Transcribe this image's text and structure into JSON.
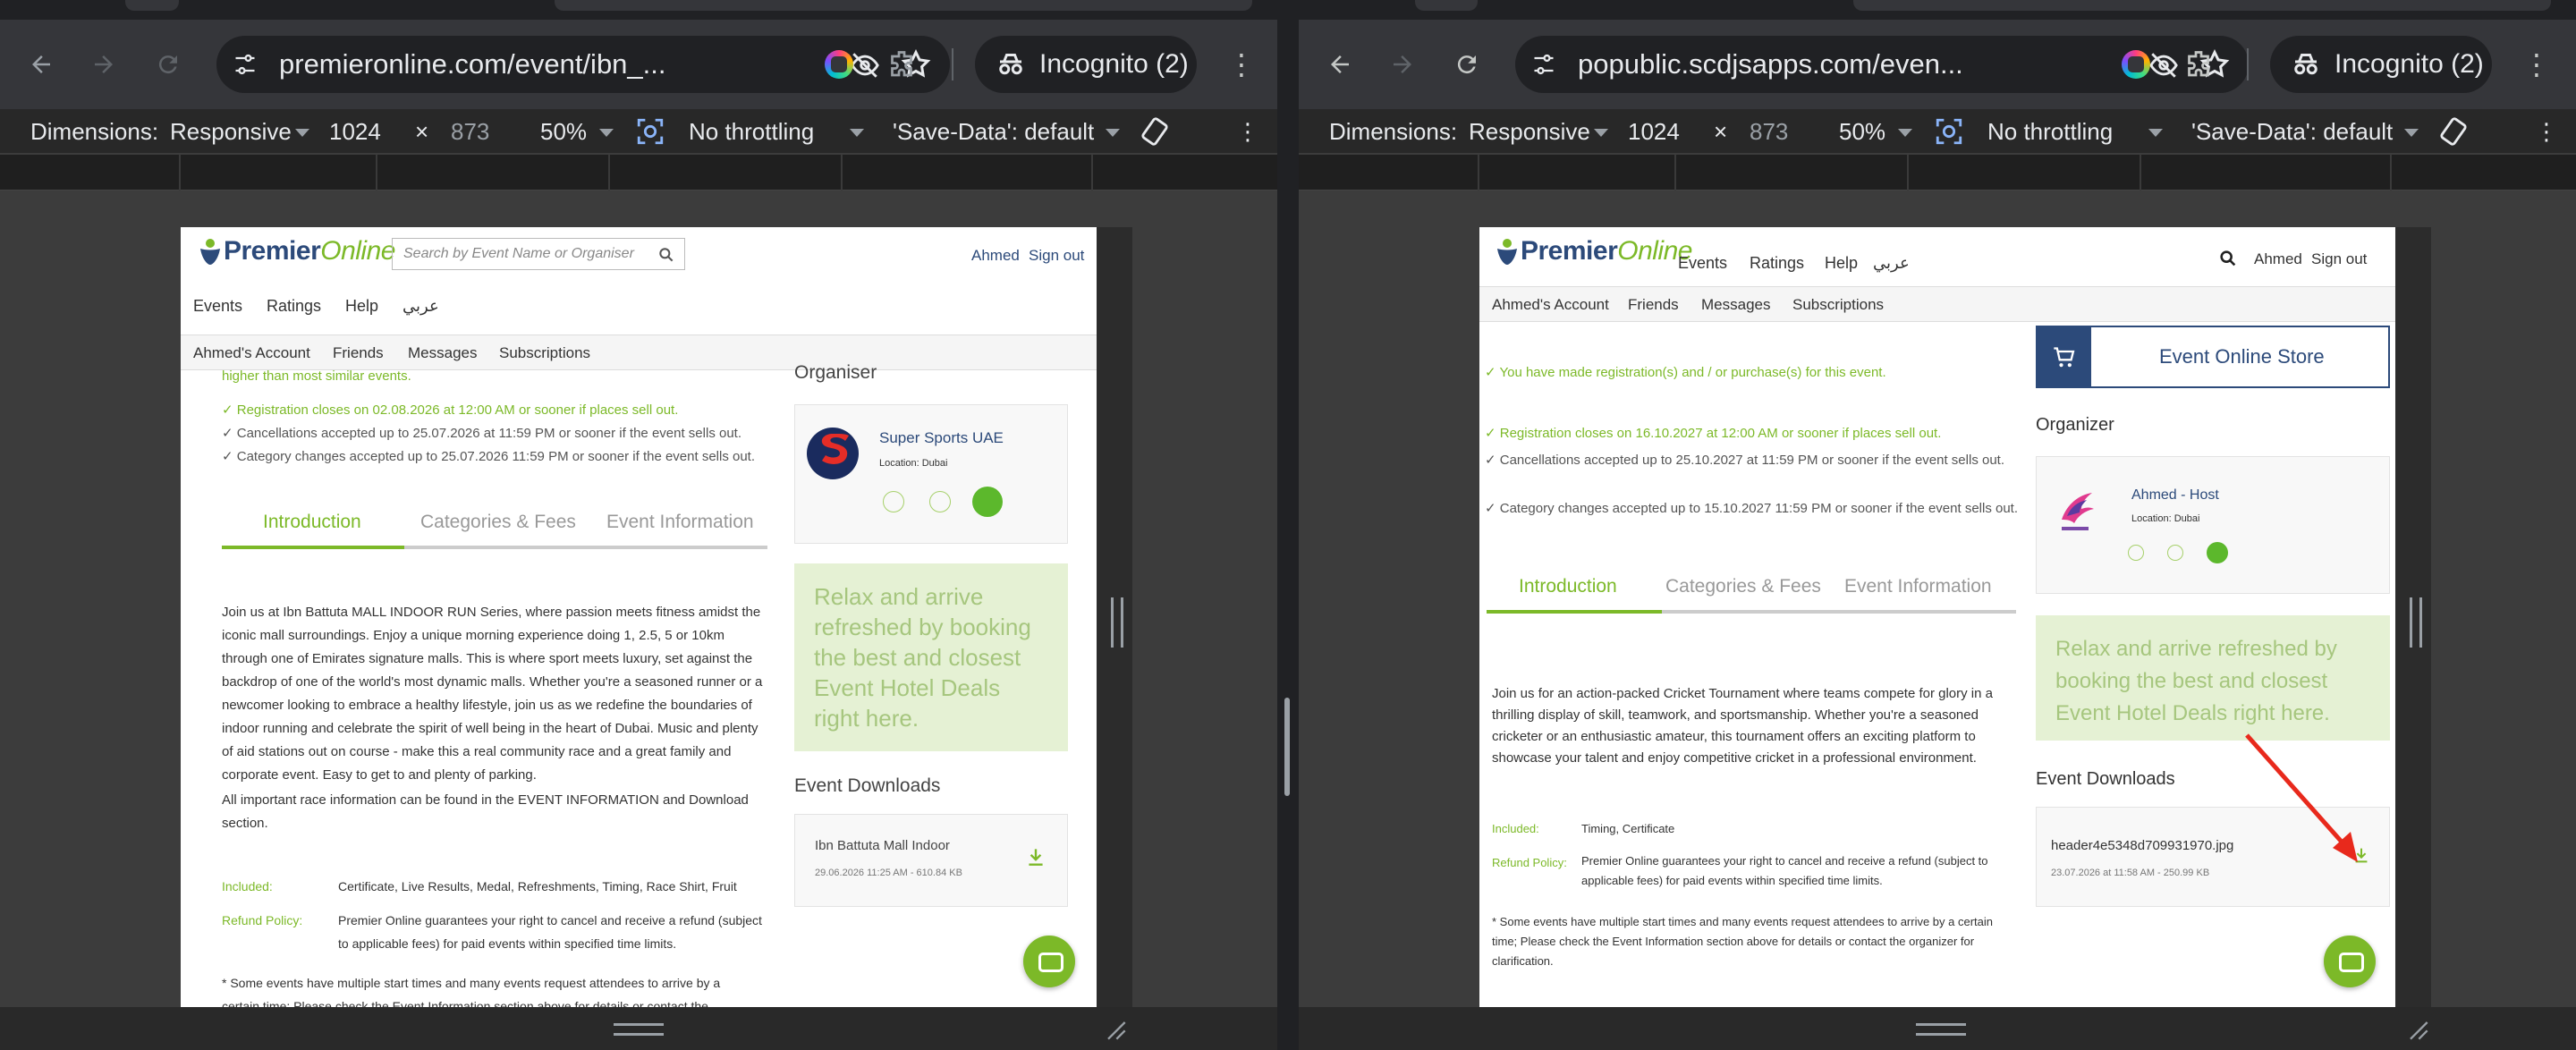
{
  "browser": {
    "incognito_label": "Incognito (2)"
  },
  "devtools": {
    "dimensions_label": "Dimensions:",
    "device": "Responsive",
    "width": "1024",
    "times": "×",
    "height": "873",
    "zoom": "50%",
    "throttling": "No throttling",
    "save_data": "'Save-Data': default"
  },
  "left": {
    "url": "premieronline.com/event/ibn_...",
    "site": {
      "logo_p": "Premier",
      "logo_o": "Online",
      "search_placeholder": "Search by Event Name or Organiser",
      "user": "Ahmed",
      "signout": "Sign out",
      "nav": [
        "Events",
        "Ratings",
        "Help",
        "عربي"
      ],
      "subnav": [
        "Ahmed's Account",
        "Friends",
        "Messages",
        "Subscriptions"
      ]
    },
    "cut_text": "higher than most similar events.",
    "reg_lines": [
      "Registration closes on 02.08.2026 at 12:00 AM or sooner if places sell out.",
      "Cancellations accepted up to 25.07.2026 at 11:59 PM or sooner if the event sells out.",
      "Category changes accepted up to 25.07.2026 11:59 PM or sooner if the event sells out."
    ],
    "tabs": [
      "Introduction",
      "Categories & Fees",
      "Event Information"
    ],
    "intro": "Join us at Ibn Battuta MALL INDOOR RUN Series, where passion meets fitness amidst the iconic mall surroundings. Enjoy a unique morning experience doing 1, 2.5, 5 or 10km through one of Emirates signature malls. This is where sport meets luxury, set against the backdrop of one of the world's most dynamic malls. Whether you're a seasoned runner or a newcomer looking to embrace a healthy lifestyle, join us as we redefine the boundaries of indoor running and celebrate the spirit of well being in the heart of Dubai.  Music and plenty of aid stations out on course - make this a real community race and a great family and corporate event. Easy to get to and plenty of parking.",
    "intro2": "All important race information can be found in the EVENT INFORMATION and Download section.",
    "included_label": "Included:",
    "included": "Certificate, Live Results, Medal, Refreshments, Timing, Race Shirt, Fruit",
    "refund_label": "Refund Policy:",
    "refund": "Premier Online guarantees your right to cancel and receive a refund (subject to applicable fees) for paid events within specified time limits.",
    "footnote": "* Some events have multiple start times and many events request attendees to arrive by a certain time; Please check the Event Information section above for details or contact the organiser for",
    "organiser_heading": "Organiser",
    "organiser_name": "Super Sports UAE",
    "organiser_location": "Location: Dubai",
    "hotel": "Relax and arrive refreshed by booking the best and closest Event Hotel Deals right here.",
    "downloads_heading": "Event Downloads",
    "download_name": "Ibn Battuta Mall Indoor",
    "download_meta": "29.06.2026 11:25 AM - 610.84 KB"
  },
  "right": {
    "url": "popublic.scdjsapps.com/even...",
    "site": {
      "logo_p": "Premier",
      "logo_o": "Online",
      "nav": [
        "Events",
        "Ratings",
        "Help",
        "عربي"
      ],
      "user": "Ahmed",
      "signout": "Sign out",
      "subnav": [
        "Ahmed's Account",
        "Friends",
        "Messages",
        "Subscriptions"
      ]
    },
    "registered": "You have made registration(s) and / or purchase(s) for this event.",
    "reg_lines": [
      "Registration closes on 16.10.2027 at 12:00 AM or sooner if places sell out.",
      "Cancellations accepted up to 25.10.2027 at 11:59 PM or sooner if the event sells out.",
      "Category changes accepted up to 15.10.2027 11:59 PM or sooner if the event sells out."
    ],
    "tabs": [
      "Introduction",
      "Categories & Fees",
      "Event Information"
    ],
    "intro": "Join us for an action-packed Cricket Tournament where teams compete for glory in a thrilling display of skill, teamwork, and sportsmanship. Whether you're a seasoned cricketer or an enthusiastic amateur, this tournament offers an exciting platform to showcase your talent and enjoy competitive cricket in a professional environment.",
    "included_label": "Included:",
    "included": "Timing, Certificate",
    "refund_label": "Refund Policy:",
    "refund": "Premier Online guarantees your right to cancel and receive a refund (subject to applicable fees) for paid events within specified time limits.",
    "footnote": "* Some events have multiple start times and many events request attendees to arrive by a certain time; Please check the Event Information section above for details or contact the organizer for clarification.",
    "store": "Event Online Store",
    "organizer_heading": "Organizer",
    "organizer_name": "Ahmed - Host",
    "organizer_location": "Location: Dubai",
    "hotel": "Relax and arrive refreshed by booking the best and closest Event Hotel Deals right here.",
    "downloads_heading": "Event Downloads",
    "download_name": "header4e5348d709931970.jpg",
    "download_meta": "23.07.2026 at 11:58 AM - 250.99 KB"
  },
  "colors": {
    "brand_green": "#7cb928",
    "brand_blue": "#2c4a7a",
    "hotel_bg": "#e5f1d4",
    "annotation_arrow": "#e8291c"
  }
}
